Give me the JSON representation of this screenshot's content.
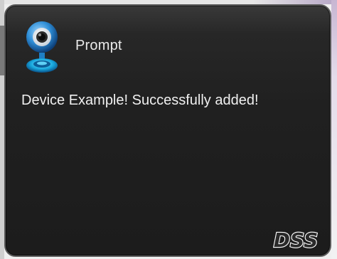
{
  "dialog": {
    "title": "Prompt",
    "message": "Device Example! Successfully added!",
    "icon": "webcam-icon",
    "logo": "DSS"
  },
  "colors": {
    "background": "#1e1e1e",
    "border": "#5a5a5a",
    "text": "#f0f0f0",
    "icon_accent": "#2f8fd8"
  }
}
